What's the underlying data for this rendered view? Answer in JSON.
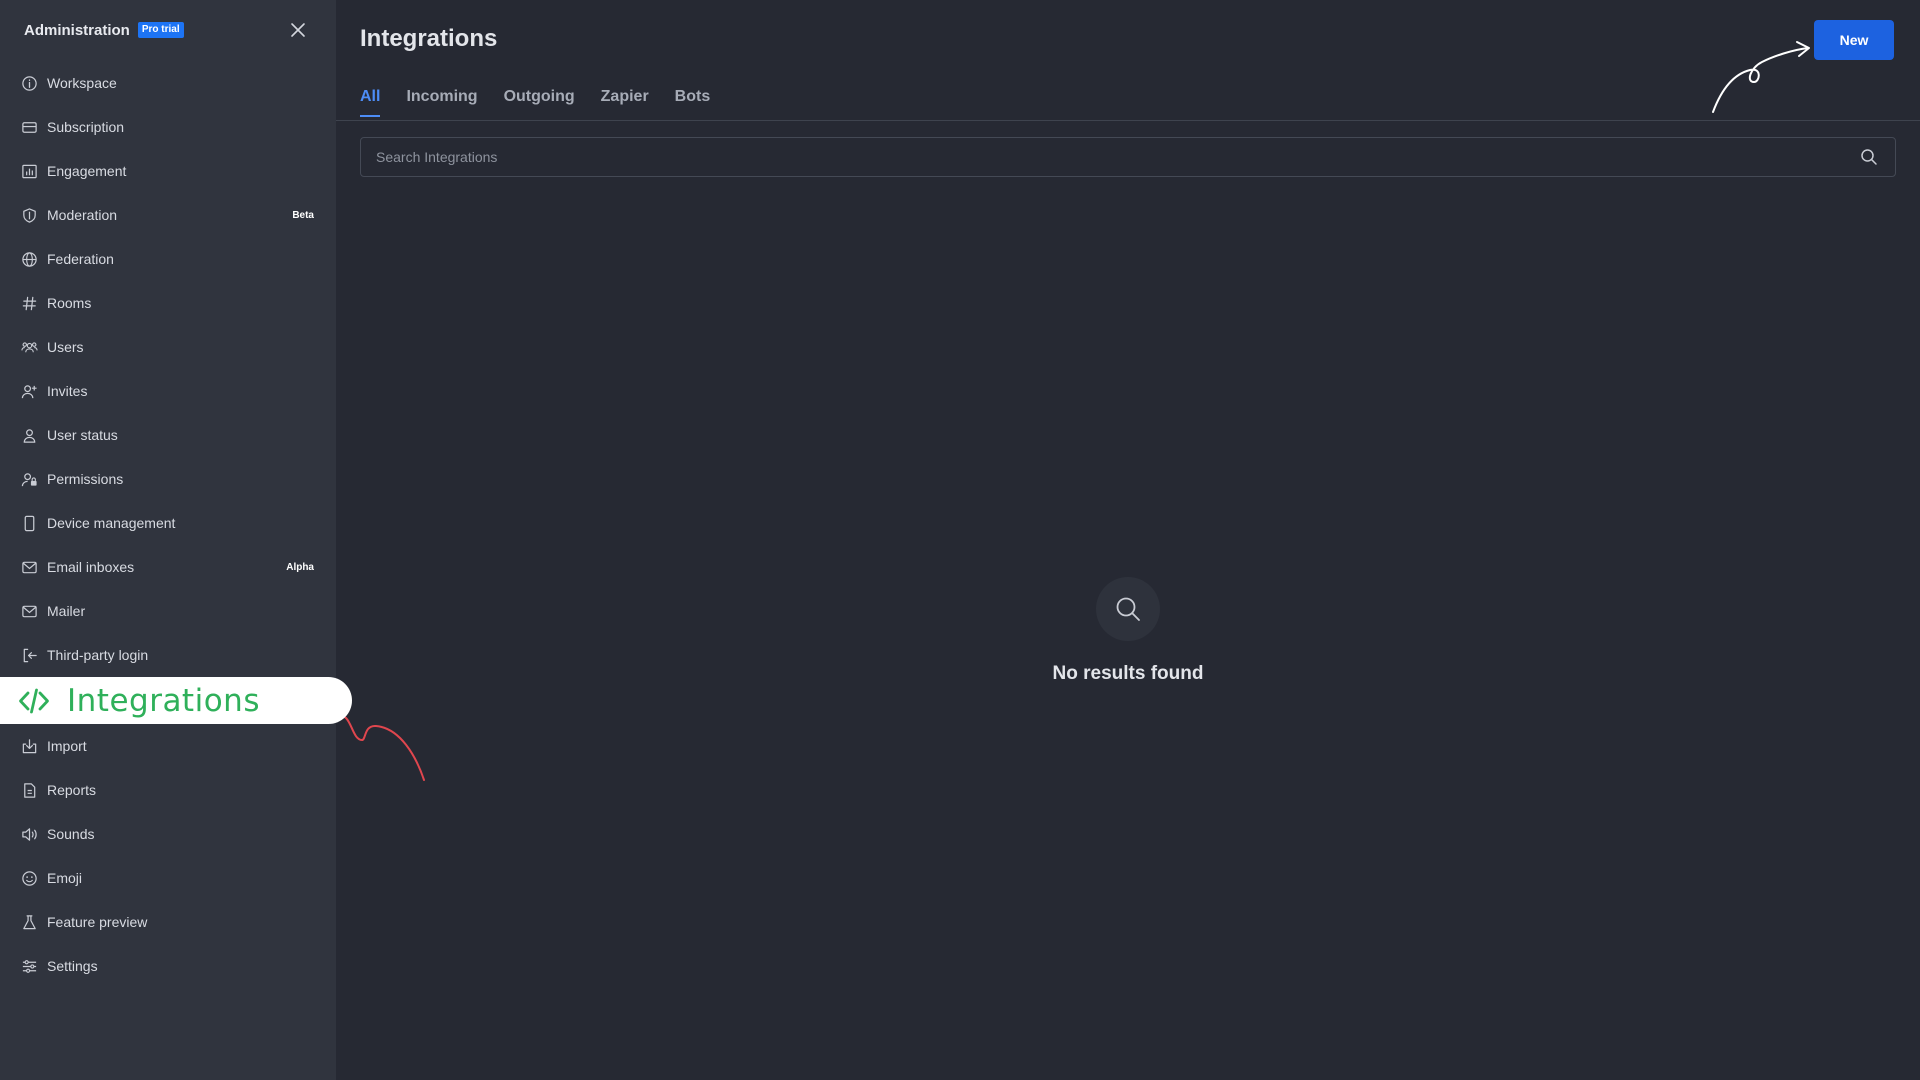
{
  "sidebar": {
    "title": "Administration",
    "badge": "Pro trial",
    "items": [
      {
        "label": "Workspace",
        "icon": "info-icon"
      },
      {
        "label": "Subscription",
        "icon": "card-icon"
      },
      {
        "label": "Engagement",
        "icon": "chart-icon"
      },
      {
        "label": "Moderation",
        "icon": "shield-icon",
        "tag": "Beta"
      },
      {
        "label": "Federation",
        "icon": "globe-icon"
      },
      {
        "label": "Rooms",
        "icon": "hash-icon"
      },
      {
        "label": "Users",
        "icon": "team-icon"
      },
      {
        "label": "Invites",
        "icon": "user-plus-icon"
      },
      {
        "label": "User status",
        "icon": "user-icon"
      },
      {
        "label": "Permissions",
        "icon": "user-lock-icon"
      },
      {
        "label": "Device management",
        "icon": "mobile-icon"
      },
      {
        "label": "Email inboxes",
        "icon": "mail-icon",
        "tag": "Alpha"
      },
      {
        "label": "Mailer",
        "icon": "mail-icon"
      },
      {
        "label": "Third-party login",
        "icon": "login-icon"
      },
      {
        "label": "Integrations",
        "icon": "code-icon"
      },
      {
        "label": "Import",
        "icon": "import-icon"
      },
      {
        "label": "Reports",
        "icon": "document-icon"
      },
      {
        "label": "Sounds",
        "icon": "volume-icon"
      },
      {
        "label": "Emoji",
        "icon": "emoji-icon"
      },
      {
        "label": "Feature preview",
        "icon": "flask-icon"
      },
      {
        "label": "Settings",
        "icon": "sliders-icon"
      }
    ]
  },
  "main": {
    "title": "Integrations",
    "new_label": "New",
    "tabs": [
      {
        "label": "All"
      },
      {
        "label": "Incoming"
      },
      {
        "label": "Outgoing"
      },
      {
        "label": "Zapier"
      },
      {
        "label": "Bots"
      }
    ],
    "search": {
      "placeholder": "Search Integrations",
      "value": ""
    },
    "empty_text": "No results found"
  },
  "colors": {
    "accent": "#1d62e0",
    "active_tab": "#4d8df7",
    "highlight_text": "#2fb05a",
    "annotation_red": "#e0464e"
  }
}
